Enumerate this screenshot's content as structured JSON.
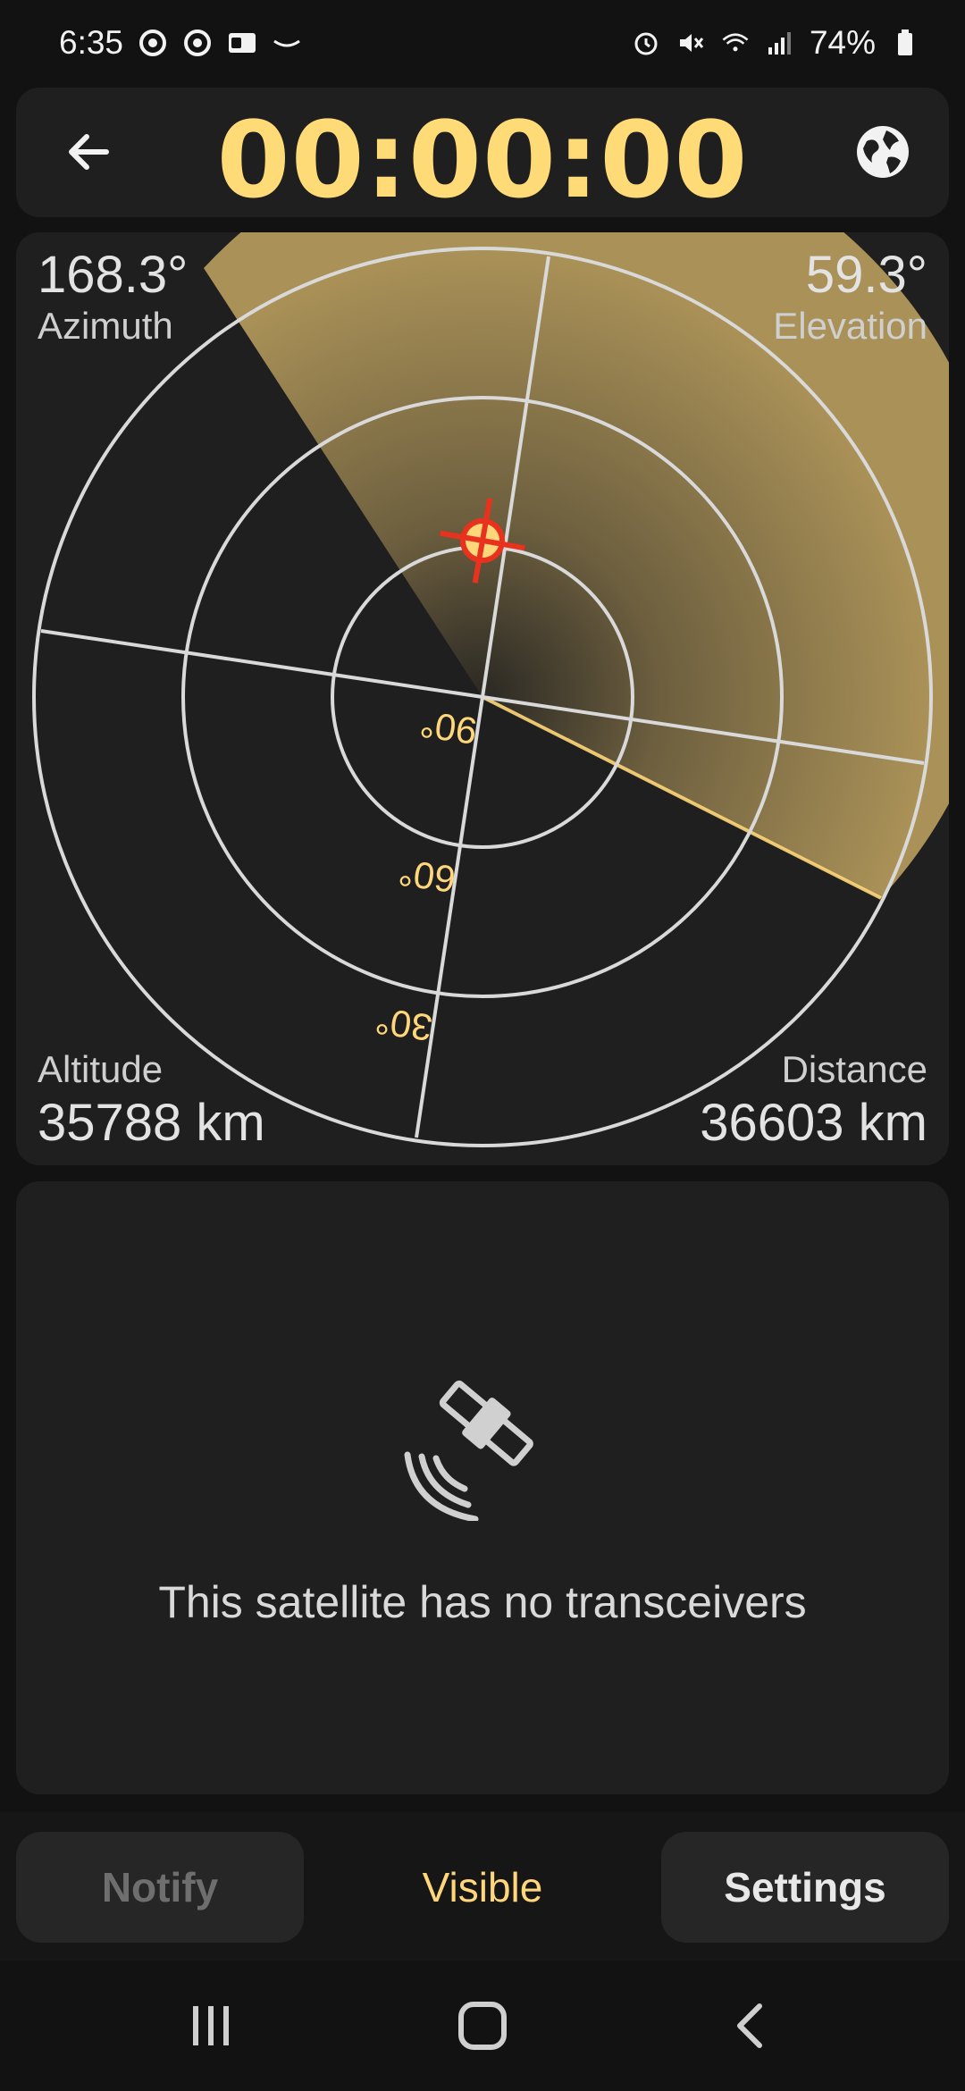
{
  "status_bar": {
    "time": "6:35",
    "battery": "74%",
    "left_icons": [
      "chrome-icon",
      "chrome-icon",
      "outlook-icon",
      "amazon-icon"
    ],
    "right_icons": [
      "alarm-icon",
      "mute-icon",
      "wifi-icon",
      "signal-icon",
      "battery-icon"
    ]
  },
  "header": {
    "timer": "00:00:00",
    "back_icon": "arrow-left-icon",
    "globe_icon": "globe-icon"
  },
  "radar": {
    "azimuth_value": "168.3°",
    "azimuth_label": "Azimuth",
    "elevation_value": "59.3°",
    "elevation_label": "Elevation",
    "altitude_label": "Altitude",
    "altitude_value": "35788 km",
    "distance_label": "Distance",
    "distance_value": "36603 km",
    "ring_labels": [
      "90°",
      "60°",
      "30°"
    ],
    "accent_color": "#ffd77a",
    "target_color": "#e8321e"
  },
  "transceivers": {
    "icon": "satellite-icon",
    "message": "This satellite has no transceivers"
  },
  "bottom_bar": {
    "notify_label": "Notify",
    "visible_label": "Visible",
    "settings_label": "Settings"
  },
  "nav_bar": {
    "icons": [
      "recents-icon",
      "home-icon",
      "back-icon"
    ]
  }
}
